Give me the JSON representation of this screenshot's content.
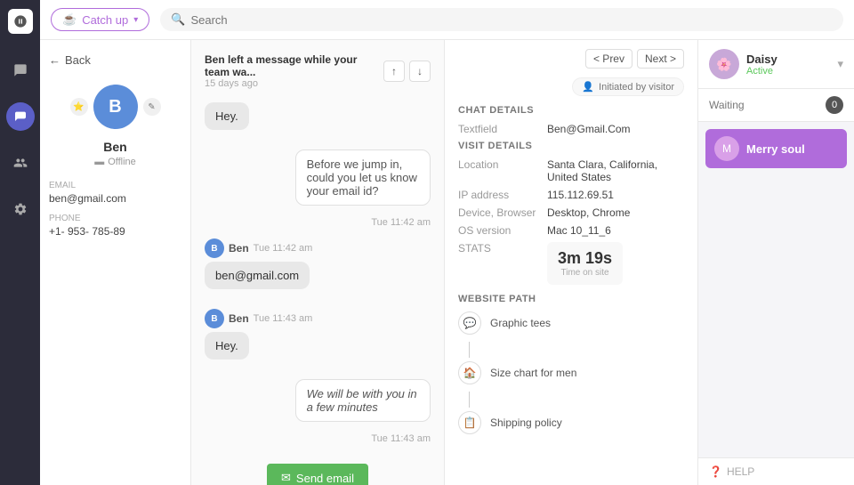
{
  "app": {
    "logo": "G"
  },
  "topbar": {
    "catchup_label": "Catch up",
    "search_placeholder": "Search"
  },
  "nav": {
    "items": [
      {
        "icon": "chat-icon",
        "label": "Chat",
        "active": false
      },
      {
        "icon": "conversations-icon",
        "label": "Conversations",
        "active": true
      },
      {
        "icon": "contacts-icon",
        "label": "Contacts",
        "active": false
      },
      {
        "icon": "settings-icon",
        "label": "Settings",
        "active": false
      }
    ]
  },
  "contact": {
    "back_label": "Back",
    "name": "Ben",
    "avatar_letter": "B",
    "status": "Offline",
    "email_label": "EMAIL",
    "email": "ben@gmail.com",
    "phone_label": "PHONE",
    "phone": "+1- 953- 785-89"
  },
  "chat": {
    "header_text_pre": "left a message while your team wa...",
    "header_sender": "Ben",
    "header_time": "15 days ago",
    "messages": [
      {
        "type": "received",
        "sender": "Ben",
        "time": "Tue 11:42 am",
        "text": "Hey.",
        "show_meta": false
      },
      {
        "type": "sent",
        "text": "Before we jump in, could you let us know your email id?",
        "time": "Tue 11:42 am"
      },
      {
        "type": "received",
        "sender": "Ben",
        "time": "Tue 11:42 am",
        "text": "ben@gmail.com",
        "show_meta": true
      },
      {
        "type": "received",
        "sender": "Ben",
        "time": "Tue 11:43 am",
        "text": "Hey.",
        "show_meta": true
      },
      {
        "type": "sent",
        "text": "We will be with you in a few minutes",
        "time": "Tue 11:43 am"
      }
    ],
    "send_email_label": "Send email"
  },
  "details": {
    "prev_label": "< Prev",
    "next_label": "Next >",
    "initiated_label": "Initiated by visitor",
    "chat_details_title": "CHAT DETAILS",
    "textfield_label": "Textfield",
    "textfield_value": "Ben@Gmail.Com",
    "visit_details_title": "VISIT DETAILS",
    "location_label": "Location",
    "location_value": "Santa Clara, California, United States",
    "ip_label": "IP address",
    "ip_value": "115.112.69.51",
    "device_label": "Device, Browser",
    "device_value": "Desktop, Chrome",
    "os_label": "OS version",
    "os_value": "Mac 10_11_6",
    "stats_label": "STATS",
    "stats_time": "3m 19s",
    "stats_subtitle": "Time on site",
    "website_path_title": "WEBSITE PATH",
    "path_items": [
      {
        "icon": "💬",
        "label": "Graphic tees"
      },
      {
        "icon": "🏠",
        "label": "Size chart for men"
      },
      {
        "icon": "📋",
        "label": "Shipping policy"
      }
    ]
  },
  "right_panel": {
    "agent_name": "Daisy",
    "agent_status": "Active",
    "waiting_label": "Waiting",
    "waiting_count": "0",
    "active_conv_name": "Merry soul",
    "help_label": "HELP"
  }
}
